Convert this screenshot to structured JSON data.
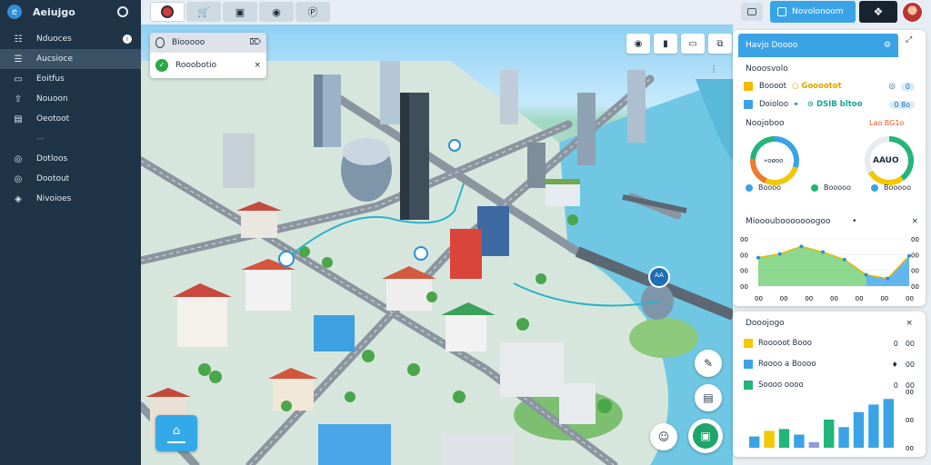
{
  "app": {
    "name": "Aeiujgo"
  },
  "sidebar": {
    "items": [
      {
        "icon": "users-icon",
        "label": "Nduoces",
        "badge": "i"
      },
      {
        "icon": "list-icon",
        "label": "Aucsioce"
      },
      {
        "icon": "monitor-icon",
        "label": "Eoitfus"
      },
      {
        "icon": "upload-icon",
        "label": "Nouoon"
      },
      {
        "icon": "briefcase-icon",
        "label": "Oeotoot"
      },
      {
        "icon": "divider",
        "label": "—"
      },
      {
        "icon": "bulb-icon",
        "label": "Dotloos"
      },
      {
        "icon": "location-icon",
        "label": "Dootout"
      },
      {
        "icon": "shield-icon",
        "label": "Nivoioes"
      }
    ]
  },
  "topbar": {
    "tabs": [
      "car-icon",
      "cart-icon",
      "briefcase-icon",
      "wallet-icon",
      "parking-icon"
    ],
    "nav_label": "Novolonoom",
    "dark_icon": "route-icon"
  },
  "map": {
    "search": {
      "label": "Biooooo",
      "icon_label": "⌦"
    },
    "destination": {
      "label": "Rooobotio",
      "close": "×"
    },
    "tools": [
      "◉",
      "▮",
      "▭",
      "⧉"
    ],
    "collapse": "⫶",
    "center_marker_label": "AA",
    "home_btn": "⌂"
  },
  "panel": {
    "header": "Havjo Doooo",
    "subtitle": "Nooosvolo",
    "stats": [
      {
        "color": "#f3b800",
        "label": "Boooot",
        "accent": "○ Gooootot",
        "tail_icon": "◎",
        "chip": "0"
      },
      {
        "color": "#3aa3e6",
        "label": "Doioloo",
        "accent": "⌖",
        "accent_2": "⊙ DSIB bltoo",
        "chip": "0 8o"
      }
    ],
    "donuts_title": "Noojoboo",
    "donuts_alert": "Lao BG1o",
    "donut_left_text": "«oøoo",
    "donut_right_text": "AAUO",
    "donut_caption_left": "Boooo",
    "donut_caption_right": "Booooo",
    "trend_title": "Mioooubooooooogoo",
    "trend_flag": "•",
    "close": "×",
    "y_ticks": [
      "00",
      "00",
      "00",
      "00"
    ],
    "x_ticks": [
      "00",
      "00",
      "00",
      "00",
      "00",
      "00",
      "00"
    ]
  },
  "bottom_panel": {
    "title": "Dooojogo",
    "close": "×",
    "items": [
      {
        "color": "#f3c800",
        "label": "Rooooot Booo",
        "ctl": "0",
        "value": "00"
      },
      {
        "color": "#3aa3e6",
        "label": "Roooo a Boooo",
        "ctl": "♦",
        "value": "00"
      },
      {
        "color": "#23b57a",
        "label": "Soooo oooo",
        "ctl": "0",
        "value": "00"
      }
    ],
    "y_ticks": [
      "00",
      "00",
      "00"
    ]
  },
  "chart_data": [
    {
      "type": "area",
      "title": "Mioooubooooooogoo",
      "x": [
        1,
        2,
        3,
        4,
        5,
        6,
        7,
        8
      ],
      "series": [
        {
          "values": [
            30,
            34,
            42,
            36,
            28,
            12,
            8,
            32
          ]
        }
      ],
      "ylim": [
        0,
        50
      ],
      "x_tick_labels": [
        "00",
        "00",
        "00",
        "00",
        "00",
        "00",
        "00"
      ],
      "y_tick_labels": [
        "00",
        "00",
        "00",
        "00"
      ],
      "colors": [
        "#65cc6a",
        "#47a9ea"
      ]
    },
    {
      "type": "bar",
      "title": "Dooojogo",
      "categories": [
        "1",
        "2",
        "3",
        "4",
        "5",
        "6",
        "7",
        "8",
        "9",
        "10"
      ],
      "values": [
        12,
        18,
        20,
        14,
        6,
        30,
        22,
        38,
        46,
        52
      ],
      "colors": [
        "#3aa3e6",
        "#f3c800",
        "#23b57a",
        "#3aa3e6",
        "#8f9bd8",
        "#23b57a",
        "#3aa3e6",
        "#3aa3e6",
        "#3aa3e6",
        "#3aa3e6"
      ],
      "ylim": [
        0,
        60
      ]
    }
  ]
}
